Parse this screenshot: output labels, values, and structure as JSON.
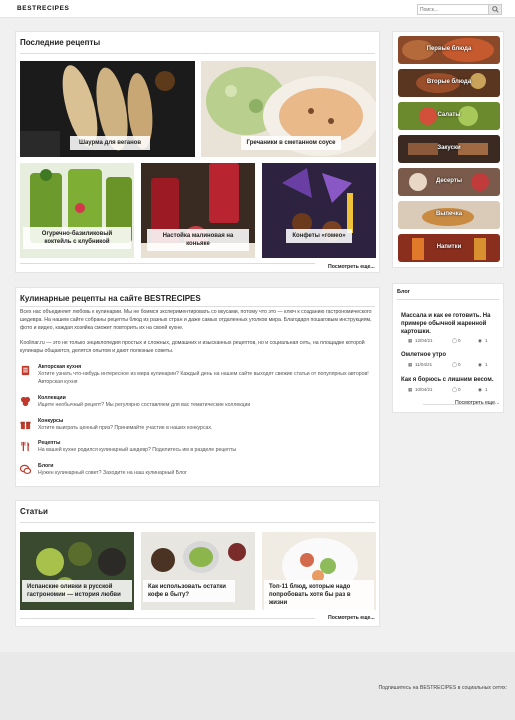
{
  "header": {
    "logo": "BESTRECIPES",
    "search_placeholder": "Поиск..."
  },
  "latest": {
    "title": "Последние рецепты",
    "more": "Посмотреть еще...",
    "items": [
      {
        "caption": "Шаурма для веганов"
      },
      {
        "caption": "Гречаники в сметанном соусе"
      },
      {
        "caption": "Огуречно-базиликовый коктейль с клубникой"
      },
      {
        "caption": "Настойка малиновая на коньяке"
      },
      {
        "caption": "Конфеты «гомео»"
      }
    ]
  },
  "about": {
    "title": "Кулинарные рецепты на сайте BESTRECIPES",
    "para1": "Всех нас объединяет любовь к кулинарии. Мы не боимся экспериментировать со вкусами, потому что это — ключ к созданию гастрономического шедевра. На нашем сайте собраны рецепты блюд из разных стран и даже самых отдаленных уголков мира. Благодаря пошаговым инструкциям, фото и видео, каждая хозяйка сможет повторить их на своей кухне.",
    "para2": "Koolinar.ru — это не только энциклопедия простых и сложных, домашних и изысканных рецептов, но и социальная сеть, на площадке которой кулинары общаются, делятся опытом и дают полезные советы.",
    "features": [
      {
        "icon": "book-icon",
        "title": "Авторская кухня",
        "desc": "Хотите узнать что-нибудь интересное из мира кулинарии? Каждый день на нашем сайте выходят свежие статьи от популярных авторов! Авторская кухня"
      },
      {
        "icon": "collection-icon",
        "title": "Коллекции",
        "desc": "Ищите необычный рецепт? Мы регулярно составляем для вас тематические коллекции"
      },
      {
        "icon": "gift-icon",
        "title": "Конкурсы",
        "desc": "Хотите выиграть ценный приз? Принимайте участие в наших конкурсах."
      },
      {
        "icon": "utensils-icon",
        "title": "Рецепты",
        "desc": "На вашей кухне родился кулинарный шедевр? Поделитесь им в разделе рецепты"
      },
      {
        "icon": "chat-icon",
        "title": "Блоги",
        "desc": "Нужен кулинарный совет? Заходите на наш кулинарный Блог"
      }
    ]
  },
  "articles": {
    "title": "Статьи",
    "more": "Посмотреть еще...",
    "items": [
      {
        "caption": "Испанские оливки в русской гастрономии — история любви"
      },
      {
        "caption": "Как использовать остатки кофе в быту?"
      },
      {
        "caption": "Топ-11 блюд, которые надо попробовать хотя бы раз в жизни"
      }
    ]
  },
  "categories": [
    {
      "label": "Первые блюда"
    },
    {
      "label": "Вторые блюда"
    },
    {
      "label": "Салаты"
    },
    {
      "label": "Закуски"
    },
    {
      "label": "Десерты"
    },
    {
      "label": "Выпечка"
    },
    {
      "label": "Напитки"
    }
  ],
  "blog": {
    "title": "Блог",
    "more": "Посмотреть еще...",
    "items": [
      {
        "title": "Массала и как ее готовить. На примере обычной жаренной картошки.",
        "date": "12/04/21",
        "comments": "0",
        "views": "1"
      },
      {
        "title": "Омлетное утро",
        "date": "11/04/21",
        "comments": "0",
        "views": "1"
      },
      {
        "title": "Как я борюсь с лишним весом.",
        "date": "10/04/21",
        "comments": "0",
        "views": "1"
      }
    ]
  },
  "footer": {
    "social_text": "Подпишитесь на BESTRECIPES в социальных сетях:"
  }
}
